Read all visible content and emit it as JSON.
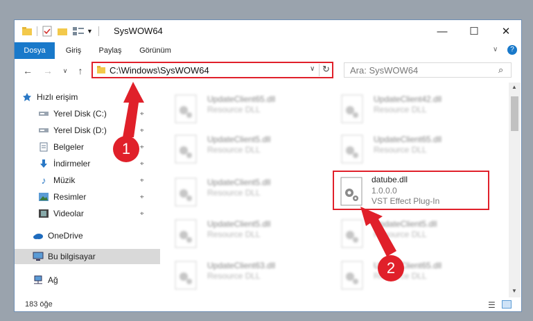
{
  "window": {
    "title": "SysWOW64",
    "quick_access_icons": [
      "folder-icon",
      "properties-icon",
      "new-folder-icon",
      "view-icon",
      "dropdown-icon"
    ]
  },
  "ribbon": {
    "tabs": [
      "Dosya",
      "Giriş",
      "Paylaş",
      "Görünüm"
    ]
  },
  "address": {
    "path": "C:\\Windows\\SysWOW64",
    "search_placeholder": "Ara: SysWOW64"
  },
  "sidebar": {
    "items": [
      {
        "label": "Hızlı erişim",
        "icon": "star-icon",
        "pinned": false
      },
      {
        "label": "Yerel Disk (C:)",
        "icon": "drive-icon",
        "pinned": true
      },
      {
        "label": "Yerel Disk (D:)",
        "icon": "drive-icon",
        "pinned": true
      },
      {
        "label": "Belgeler",
        "icon": "documents-icon",
        "pinned": true
      },
      {
        "label": "İndirmeler",
        "icon": "download-icon",
        "pinned": true
      },
      {
        "label": "Müzik",
        "icon": "music-icon",
        "pinned": true
      },
      {
        "label": "Resimler",
        "icon": "pictures-icon",
        "pinned": true
      },
      {
        "label": "Videolar",
        "icon": "video-icon",
        "pinned": true
      },
      {
        "label": "OneDrive",
        "icon": "cloud-icon",
        "pinned": false
      },
      {
        "label": "Bu bilgisayar",
        "icon": "computer-icon",
        "pinned": false
      },
      {
        "label": "Ağ",
        "icon": "network-icon",
        "pinned": false
      }
    ]
  },
  "files": [
    {
      "name": "UpdateClient65.dll",
      "type": "Resource DLL"
    },
    {
      "name": "UpdateClient42.dll",
      "type": "Resource DLL"
    },
    {
      "name": "UpdateClient5.dll",
      "type": "Resource DLL"
    },
    {
      "name": "UpdateClient65.dll",
      "type": "Resource DLL"
    },
    {
      "name": "UpdateClient5.dll",
      "type": "Resource DLL"
    },
    {
      "name": "datube.dll",
      "version": "1.0.0.0",
      "type": "VST Effect Plug-In"
    },
    {
      "name": "UpdateClient5.dll",
      "type": "Resource DLL"
    },
    {
      "name": "UpdateClient5.dll",
      "type": "Resource DLL"
    },
    {
      "name": "UpdateClient63.dll",
      "type": "Resource DLL"
    },
    {
      "name": "UpdateClient65.dll",
      "type": "Resource DLL"
    }
  ],
  "status": {
    "item_count": "183 öğe"
  },
  "annotations": {
    "badge1": "1",
    "badge2": "2"
  },
  "colors": {
    "accent": "#1979ca",
    "highlight": "#e0202a"
  }
}
